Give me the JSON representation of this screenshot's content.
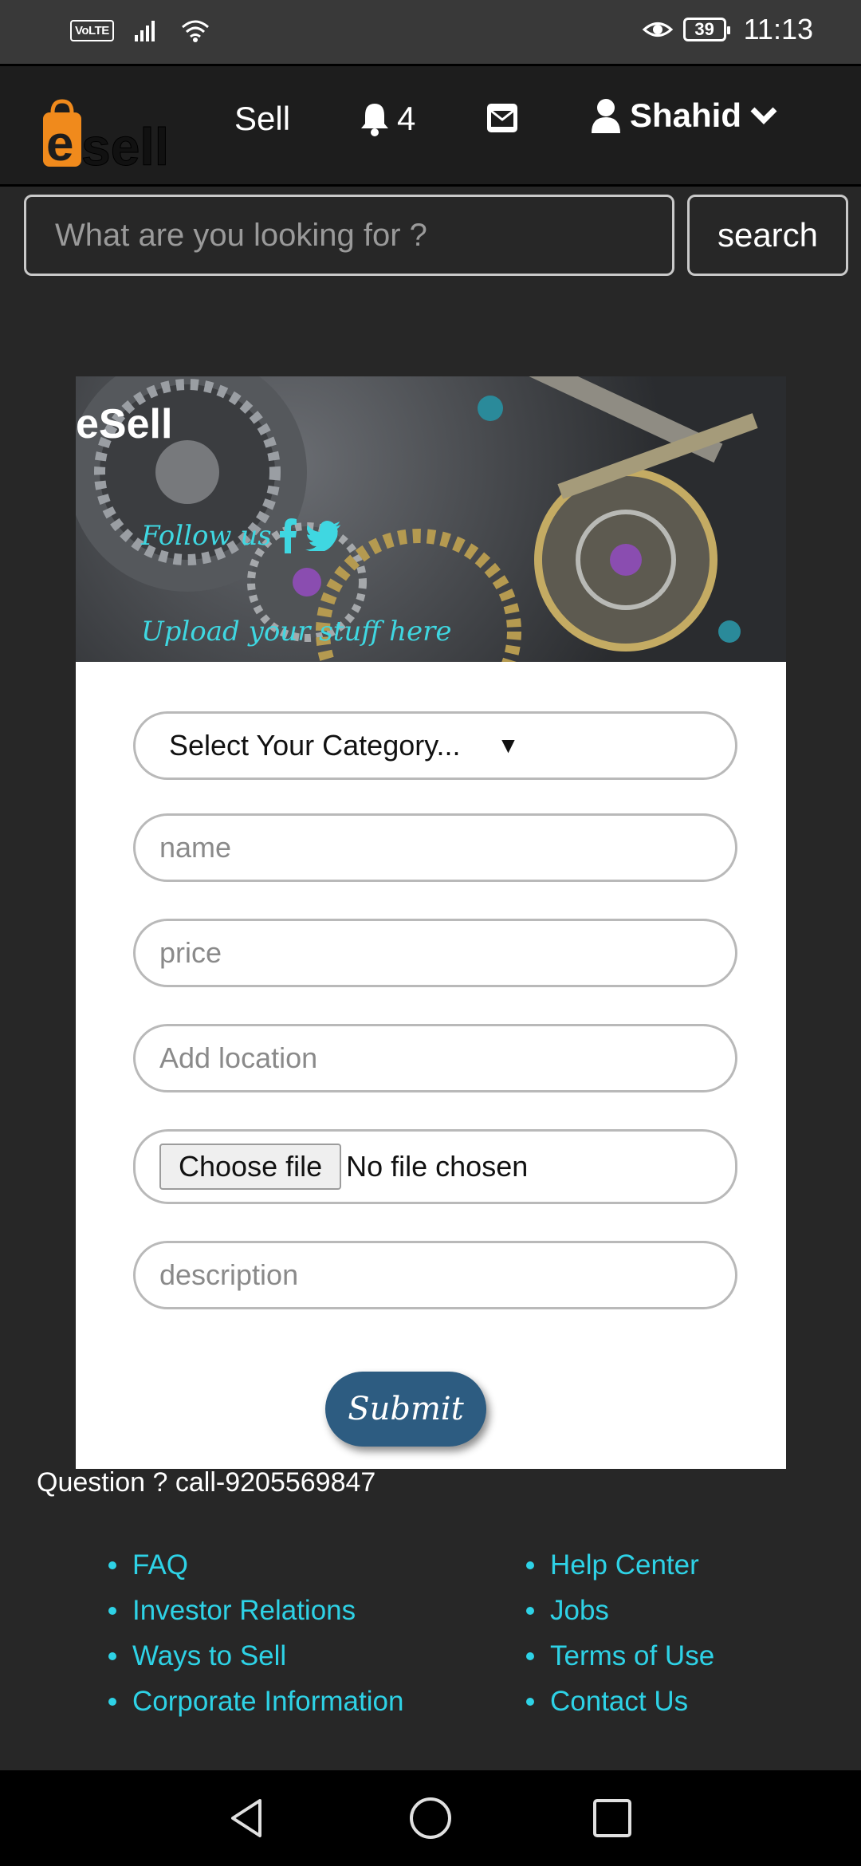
{
  "status_bar": {
    "network_badge": "VoLTE",
    "battery": "39",
    "time": "11:13",
    "icons": [
      "signal-icon",
      "wifi-icon",
      "eye-icon",
      "battery-icon"
    ]
  },
  "nav": {
    "logo_text": "sell",
    "sell_label": "Sell",
    "notification_count": "4",
    "user_name": "Shahid",
    "icons": [
      "bell-icon",
      "mail-icon",
      "user-icon",
      "chevron-down-icon"
    ]
  },
  "search": {
    "placeholder": "What are you looking for ?",
    "button_label": "search"
  },
  "banner": {
    "title": "eSell",
    "follow_text": "Follow us",
    "upload_text": "Upload your stuff here"
  },
  "form": {
    "category_select": "Select Your Category...",
    "name_placeholder": "name",
    "price_placeholder": "price",
    "location_placeholder": "Add location",
    "file_button": "Choose file",
    "file_status": "No file chosen",
    "description_placeholder": "description",
    "submit_label": "Submit"
  },
  "footer": {
    "question": "Question ? call-9205569847",
    "links_left": [
      "FAQ",
      "Investor Relations",
      "Ways to Sell",
      "Corporate Information"
    ],
    "links_right": [
      "Help Center",
      "Jobs",
      "Terms of Use",
      "Contact Us"
    ]
  },
  "colors": {
    "background": "#272727",
    "accent_link": "#2ed2e6",
    "submit": "#2d5c81",
    "logo_orange": "#f08a1c"
  }
}
